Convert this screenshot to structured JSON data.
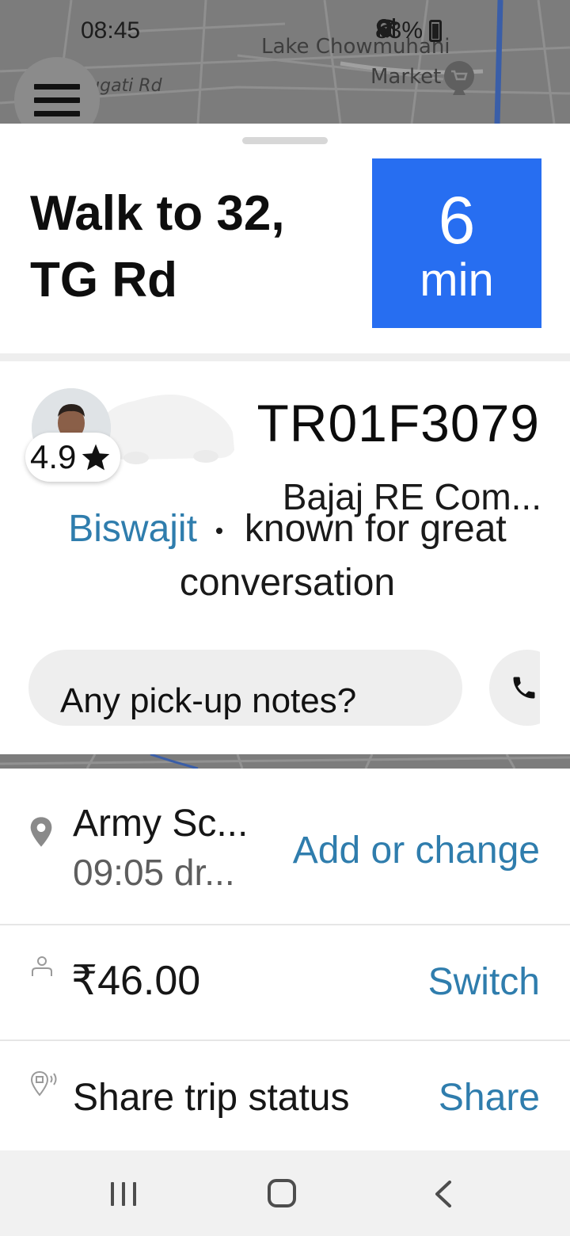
{
  "status_bar": {
    "time": "08:45",
    "battery": "83%"
  },
  "map": {
    "label_road": "ıgati Rd",
    "label_poi_line1": "Lake Chowmuhani",
    "label_poi_line2": "Market"
  },
  "trip_card": {
    "walk_title": "Walk to 32, TG Rd",
    "eta_value": "6",
    "eta_unit": "min"
  },
  "driver": {
    "rating": "4.9",
    "plate": "TR01F3079",
    "vehicle": "Bajaj RE Com...",
    "name": "Biswajit",
    "compliment": "known for great conversation",
    "notes_placeholder": "Any pick-up notes?"
  },
  "trip_details": {
    "destination_name": "Army Sc...",
    "destination_time": "09:05 dr...",
    "destination_action": "Add or change",
    "fare": "₹46.00",
    "fare_action": "Switch",
    "share_label": "Share trip status",
    "share_action": "Share"
  },
  "colors": {
    "accent_blue": "#276ef1",
    "link_blue": "#2f7dad",
    "map_grey": "#7c7c7c"
  },
  "icons": [
    "menu-icon",
    "star-icon",
    "phone-icon",
    "location-pin-icon",
    "person-icon",
    "share-location-icon",
    "recent-apps-icon",
    "home-icon",
    "back-icon"
  ]
}
